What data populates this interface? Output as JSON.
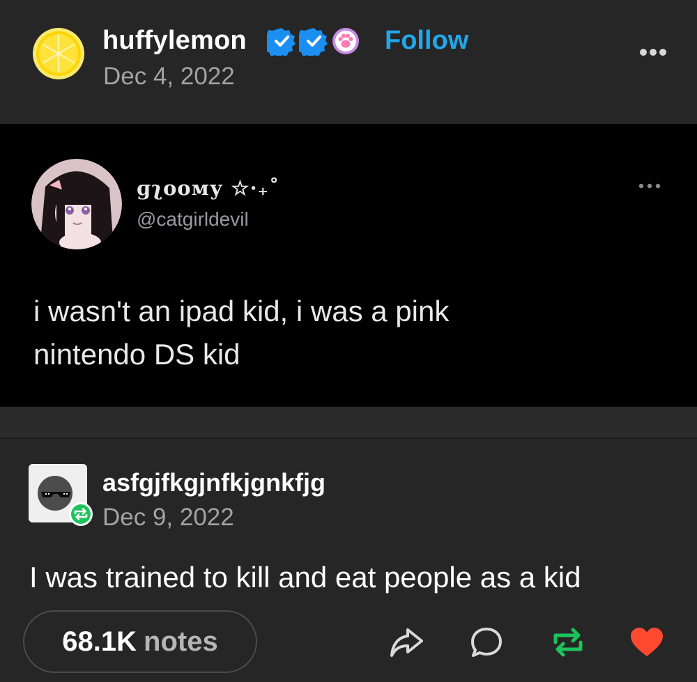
{
  "post": {
    "username": "huffylemon",
    "follow_label": "Follow",
    "date": "Dec 4, 2022",
    "badges": [
      "verified-badge-icon",
      "verified-badge-icon",
      "paw-badge-icon"
    ]
  },
  "embedded_tweet": {
    "display_name": "ɡʅοοму ☆·₊˚",
    "handle": "@catgirldevil",
    "text_line1": "i wasn't an ipad kid, i was a pink",
    "text_line2": "nintendo DS kid"
  },
  "reblog": {
    "username": "asfgjfkgjnfkjgnkfjg",
    "date": "Dec 9, 2022",
    "text": "I was trained to kill and eat people as a kid"
  },
  "footer": {
    "notes_count": "68.1K",
    "notes_label": "notes",
    "actions": [
      "share-icon",
      "reply-icon",
      "reblog-icon",
      "like-icon"
    ]
  },
  "colors": {
    "background": "#262626",
    "follow": "#22a7ea",
    "reblog_green": "#1ec35b",
    "like_red": "#ff4930",
    "verified_blue": "#1b8ef2"
  }
}
